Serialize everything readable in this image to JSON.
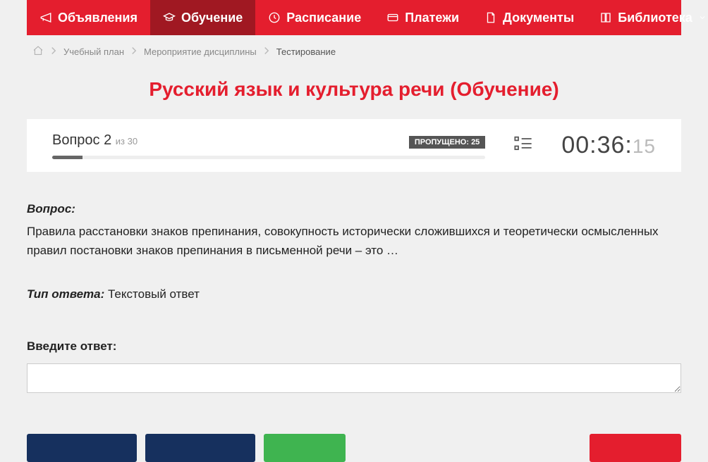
{
  "nav": {
    "items": [
      {
        "label": "Объявления",
        "icon": "megaphone"
      },
      {
        "label": "Обучение",
        "icon": "graduation",
        "active": true
      },
      {
        "label": "Расписание",
        "icon": "clock"
      },
      {
        "label": "Платежи",
        "icon": "card"
      },
      {
        "label": "Документы",
        "icon": "document"
      },
      {
        "label": "Библиотека",
        "icon": "book",
        "hasChevron": true
      }
    ]
  },
  "breadcrumbs": {
    "items": [
      {
        "label": "Учебный план"
      },
      {
        "label": "Мероприятие дисциплины"
      },
      {
        "label": "Тестирование",
        "current": true
      }
    ]
  },
  "page_title": "Русский язык и культура речи (Обучение)",
  "status": {
    "question_prefix": "Вопрос",
    "question_number": "2",
    "question_total_prefix": "из",
    "question_total": "30",
    "skipped_label": "ПРОПУЩЕНО:",
    "skipped_count": "25",
    "timer_main": "00:36:",
    "timer_seconds": "15"
  },
  "question": {
    "heading": "Вопрос:",
    "text": "Правила расстановки знаков препинания, совокупность исторически сложившихся и теоретически осмысленных правил постановки знаков препинания в письменной речи – это …",
    "answer_type_label": "Тип ответа:",
    "answer_type_value": "Текстовый ответ",
    "input_label": "Введите ответ:"
  }
}
